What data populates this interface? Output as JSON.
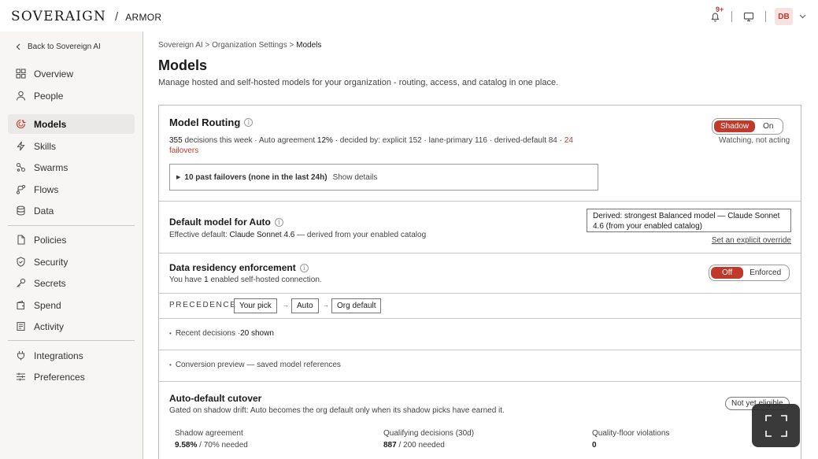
{
  "app": {
    "brand": "SOVERAIGN",
    "separator": "/",
    "product": "ARMOR"
  },
  "topbar": {
    "notification_badge": "9+",
    "avatar_initials": "DB"
  },
  "sidebar": {
    "back_label": "Back to Sovereign AI",
    "items": [
      {
        "label": "Overview",
        "icon": "grid-icon"
      },
      {
        "label": "People",
        "icon": "person-icon"
      },
      {
        "label": "Models",
        "icon": "brain-icon",
        "active": true
      },
      {
        "label": "Skills",
        "icon": "bolt-icon"
      },
      {
        "label": "Swarms",
        "icon": "swarm-icon"
      },
      {
        "label": "Flows",
        "icon": "flow-icon"
      },
      {
        "label": "Data",
        "icon": "database-icon"
      },
      {
        "label": "Policies",
        "icon": "document-icon"
      },
      {
        "label": "Security",
        "icon": "shield-icon"
      },
      {
        "label": "Secrets",
        "icon": "key-icon"
      },
      {
        "label": "Spend",
        "icon": "wallet-icon"
      },
      {
        "label": "Activity",
        "icon": "activity-icon"
      },
      {
        "label": "Integrations",
        "icon": "plug-icon"
      },
      {
        "label": "Preferences",
        "icon": "sliders-icon"
      }
    ]
  },
  "breadcrumb": {
    "part1": "Sovereign AI",
    "sep": ">",
    "part2": "Organization Settings",
    "current": "Models"
  },
  "page": {
    "title": "Models",
    "subtitle": "Manage hosted and self-hosted models for your organization - routing, access, and catalog in one place."
  },
  "routing": {
    "title": "Model Routing",
    "decisions_count": "355",
    "decisions_text": " decisions this week · Auto agreement ",
    "agreement": "12%",
    "decided_by": " · decided by: explicit 152 · lane-primary 116 · derived-default 84 · ",
    "failovers_num": "24",
    "failovers_word": "failovers",
    "mode_options": [
      "Shadow",
      "On"
    ],
    "mode_selected": "Shadow",
    "status_note": "Watching, not acting",
    "past_failovers": "10 past failovers (none in the last 24h)",
    "show_details": "Show details"
  },
  "default_model": {
    "title": "Default model for Auto",
    "effective_prefix": "Effective default: ",
    "effective_model": "Claude Sonnet 4.6",
    "effective_suffix": " — derived from your enabled catalog",
    "derived_box": "Derived: strongest Balanced model — Claude Sonnet 4.6 (from your enabled catalog)",
    "override_link": "Set an explicit override"
  },
  "residency": {
    "title": "Data residency enforcement",
    "note_prefix": "You have ",
    "note_count": "1",
    "note_suffix": " enabled self-hosted connection.",
    "options": [
      "Off",
      "Enforced"
    ],
    "selected": "Off"
  },
  "precedence": {
    "label": "PRECEDENCE",
    "steps": [
      "Your pick",
      "Auto",
      "Org default"
    ],
    "arrow": "→"
  },
  "recent": {
    "label": "Recent decisions · ",
    "count": "20 shown"
  },
  "conversion": {
    "label": "Conversion preview — saved model references"
  },
  "cutover": {
    "title": "Auto-default cutover",
    "description": "Gated on shadow drift: Auto becomes the org default only when its shadow picks have earned it.",
    "status_pill": "Not yet eligible",
    "metrics": [
      {
        "label": "Shadow agreement",
        "value": "9.58%",
        "suffix": " / 70% needed"
      },
      {
        "label": "Qualifying decisions (30d)",
        "value": "887",
        "suffix": " / 200 needed"
      },
      {
        "label": "Quality-floor violations",
        "value": "0",
        "suffix": ""
      }
    ]
  },
  "colors": {
    "accent": "#c0392b",
    "sidebar_bg": "#f7f6f5",
    "active_item_bg": "#ebe9e7"
  }
}
